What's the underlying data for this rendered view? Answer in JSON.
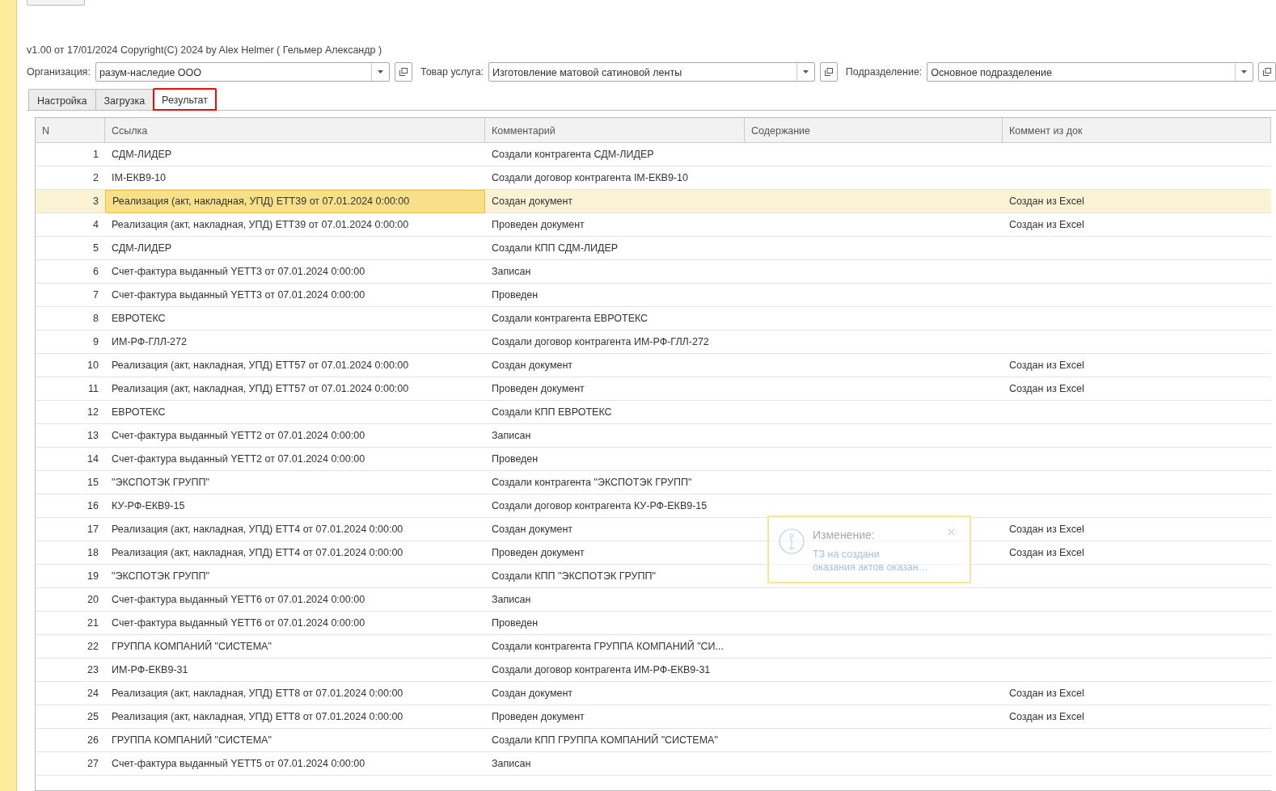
{
  "version_line": "v1.00 от 17/01/2024  Copyright(C) 2024 by Alex Helmer ( Гельмер Александр )",
  "fields": [
    {
      "label": "Организация:",
      "value": "разум-наследие ООО"
    },
    {
      "label": "Товар услуга:",
      "value": "Изготовление матовой сатиновой ленты"
    },
    {
      "label": "Подразделение:",
      "value": "Основное подразделение"
    }
  ],
  "tabs": [
    {
      "label": "Настройка",
      "selected": false,
      "annotated": false
    },
    {
      "label": "Загрузка",
      "selected": false,
      "annotated": false
    },
    {
      "label": "Результат",
      "selected": true,
      "annotated": true
    }
  ],
  "table": {
    "columns": [
      "N",
      "Ссылка",
      "Комментарий",
      "Содержание",
      "Коммент из док"
    ],
    "rows": [
      {
        "n": "1",
        "link": "СДМ-ЛИДЕР",
        "comment": "Создали контрагента СДМ-ЛИДЕР",
        "doc_comment": "",
        "selected": false
      },
      {
        "n": "2",
        "link": "IM-ЕКВ9-10",
        "comment": "Создали договор контрагента IM-ЕКВ9-10",
        "doc_comment": "",
        "selected": false
      },
      {
        "n": "3",
        "link": "Реализация (акт, накладная, УПД) ЕТТ39 от 07.01.2024 0:00:00",
        "comment": "Создан документ",
        "doc_comment": "Создан из Excel",
        "selected": true
      },
      {
        "n": "4",
        "link": "Реализация (акт, накладная, УПД) ЕТТ39 от 07.01.2024 0:00:00",
        "comment": "Проведен документ",
        "doc_comment": "Создан из Excel",
        "selected": false
      },
      {
        "n": "5",
        "link": "СДМ-ЛИДЕР",
        "comment": "Создали КПП СДМ-ЛИДЕР",
        "doc_comment": "",
        "selected": false
      },
      {
        "n": "6",
        "link": "Счет-фактура выданный YETT3 от 07.01.2024 0:00:00",
        "comment": "Записан",
        "doc_comment": "",
        "selected": false
      },
      {
        "n": "7",
        "link": "Счет-фактура выданный YETT3 от 07.01.2024 0:00:00",
        "comment": "Проведен",
        "doc_comment": "",
        "selected": false
      },
      {
        "n": "8",
        "link": "ЕВРОТЕКС",
        "comment": "Создали контрагента ЕВРОТЕКС",
        "doc_comment": "",
        "selected": false
      },
      {
        "n": "9",
        "link": "ИМ-РФ-ГЛЛ-272",
        "comment": "Создали договор контрагента ИМ-РФ-ГЛЛ-272",
        "doc_comment": "",
        "selected": false
      },
      {
        "n": "10",
        "link": "Реализация (акт, накладная, УПД) ЕТТ57 от 07.01.2024 0:00:00",
        "comment": "Создан документ",
        "doc_comment": "Создан из Excel",
        "selected": false
      },
      {
        "n": "11",
        "link": "Реализация (акт, накладная, УПД) ЕТТ57 от 07.01.2024 0:00:00",
        "comment": "Проведен документ",
        "doc_comment": "Создан из Excel",
        "selected": false
      },
      {
        "n": "12",
        "link": "ЕВРОТЕКС",
        "comment": "Создали КПП ЕВРОТЕКС",
        "doc_comment": "",
        "selected": false
      },
      {
        "n": "13",
        "link": "Счет-фактура выданный YETT2 от 07.01.2024 0:00:00",
        "comment": "Записан",
        "doc_comment": "",
        "selected": false
      },
      {
        "n": "14",
        "link": "Счет-фактура выданный YETT2 от 07.01.2024 0:00:00",
        "comment": "Проведен",
        "doc_comment": "",
        "selected": false
      },
      {
        "n": "15",
        "link": "\"ЭКСПОТЭК ГРУПП\"",
        "comment": "Создали контрагента \"ЭКСПОТЭК ГРУПП\"",
        "doc_comment": "",
        "selected": false
      },
      {
        "n": "16",
        "link": "КУ-РФ-ЕКВ9-15",
        "comment": "Создали договор контрагента КУ-РФ-ЕКВ9-15",
        "doc_comment": "",
        "selected": false
      },
      {
        "n": "17",
        "link": "Реализация (акт, накладная, УПД) ЕТТ4 от 07.01.2024 0:00:00",
        "comment": "Создан документ",
        "doc_comment": "Создан из Excel",
        "selected": false
      },
      {
        "n": "18",
        "link": "Реализация (акт, накладная, УПД) ЕТТ4 от 07.01.2024 0:00:00",
        "comment": "Проведен документ",
        "doc_comment": "Создан из Excel",
        "selected": false
      },
      {
        "n": "19",
        "link": "\"ЭКСПОТЭК ГРУПП\"",
        "comment": "Создали КПП \"ЭКСПОТЭК ГРУПП\"",
        "doc_comment": "",
        "selected": false
      },
      {
        "n": "20",
        "link": "Счет-фактура выданный YETT6 от 07.01.2024 0:00:00",
        "comment": "Записан",
        "doc_comment": "",
        "selected": false
      },
      {
        "n": "21",
        "link": "Счет-фактура выданный YETT6 от 07.01.2024 0:00:00",
        "comment": "Проведен",
        "doc_comment": "",
        "selected": false
      },
      {
        "n": "22",
        "link": "ГРУППА КОМПАНИЙ \"СИСТЕМА\"",
        "comment": "Создали контрагента ГРУППА КОМПАНИЙ \"СИ...",
        "doc_comment": "",
        "selected": false
      },
      {
        "n": "23",
        "link": "ИМ-РФ-ЕКВ9-31",
        "comment": "Создали договор контрагента ИМ-РФ-ЕКВ9-31",
        "doc_comment": "",
        "selected": false
      },
      {
        "n": "24",
        "link": "Реализация (акт, накладная, УПД) ЕТТ8 от 07.01.2024 0:00:00",
        "comment": "Создан документ",
        "doc_comment": "Создан из Excel",
        "selected": false
      },
      {
        "n": "25",
        "link": "Реализация (акт, накладная, УПД) ЕТТ8 от 07.01.2024 0:00:00",
        "comment": "Проведен документ",
        "doc_comment": "Создан из Excel",
        "selected": false
      },
      {
        "n": "26",
        "link": "ГРУППА КОМПАНИЙ \"СИСТЕМА\"",
        "comment": "Создали КПП ГРУППА КОМПАНИЙ \"СИСТЕМА\"",
        "doc_comment": "",
        "selected": false
      },
      {
        "n": "27",
        "link": "Счет-фактура выданный YETT5 от 07.01.2024 0:00:00",
        "comment": "Записан",
        "doc_comment": "",
        "selected": false
      }
    ]
  },
  "notification": {
    "title": "Изменение:",
    "text": "ТЗ на создани",
    "text_2": "оказания актов оказан…"
  }
}
